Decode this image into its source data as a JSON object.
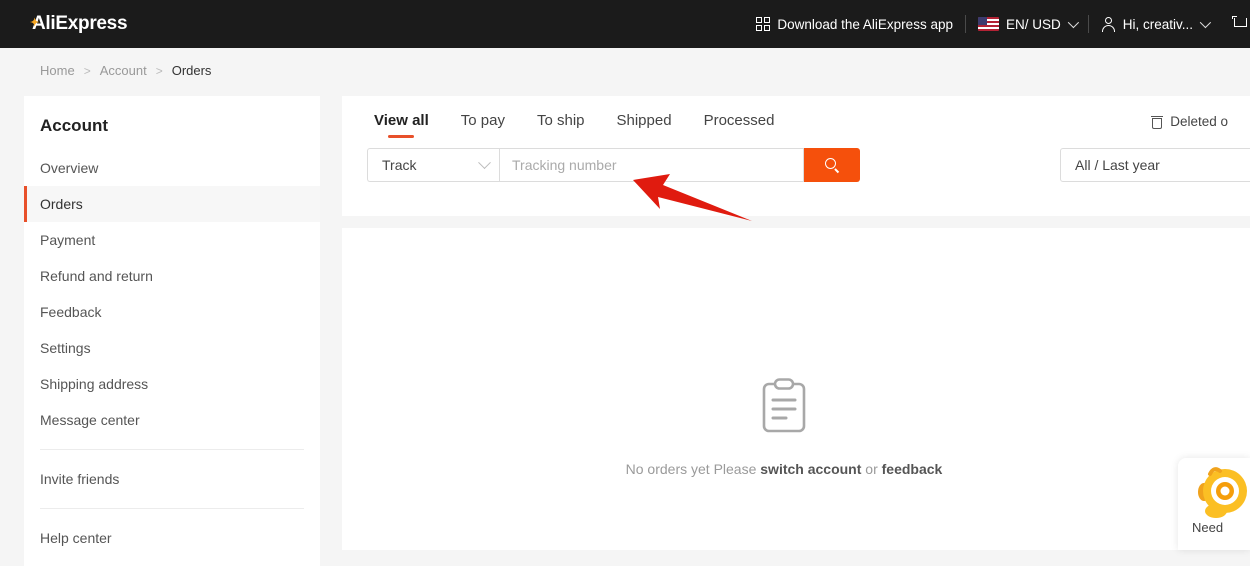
{
  "header": {
    "logo": "AliExpress",
    "download_app": "Download the AliExpress app",
    "locale": "EN/ USD",
    "account_greeting": "Hi, creativ...",
    "cart_label": ""
  },
  "breadcrumb": {
    "home": "Home",
    "sep1": ">",
    "account": "Account",
    "sep2": ">",
    "current": "Orders"
  },
  "sidebar": {
    "title": "Account",
    "items": [
      {
        "label": "Overview",
        "active": false
      },
      {
        "label": "Orders",
        "active": true
      },
      {
        "label": "Payment",
        "active": false
      },
      {
        "label": "Refund and return",
        "active": false
      },
      {
        "label": "Feedback",
        "active": false
      },
      {
        "label": "Settings",
        "active": false
      },
      {
        "label": "Shipping address",
        "active": false
      },
      {
        "label": "Message center",
        "active": false
      }
    ],
    "invite": "Invite friends",
    "help": "Help center"
  },
  "orders": {
    "tabs": [
      {
        "label": "View all",
        "active": true
      },
      {
        "label": "To pay",
        "active": false
      },
      {
        "label": "To ship",
        "active": false
      },
      {
        "label": "Shipped",
        "active": false
      },
      {
        "label": "Processed",
        "active": false
      }
    ],
    "deleted_orders": "Deleted o",
    "search": {
      "type_value": "Track",
      "input_value": "",
      "placeholder": "Tracking number"
    },
    "date_filter": "All / Last year",
    "empty": {
      "prefix": "No orders yet Please ",
      "link1": "switch account",
      "middle": " or ",
      "link2": "feedback"
    }
  },
  "help_widget": {
    "label": "Need"
  },
  "colors": {
    "brand_orange": "#f5500c",
    "active_indicator": "#e8502a",
    "header_bg": "#1b1b1b",
    "annotation_red": "#e01b0f"
  }
}
